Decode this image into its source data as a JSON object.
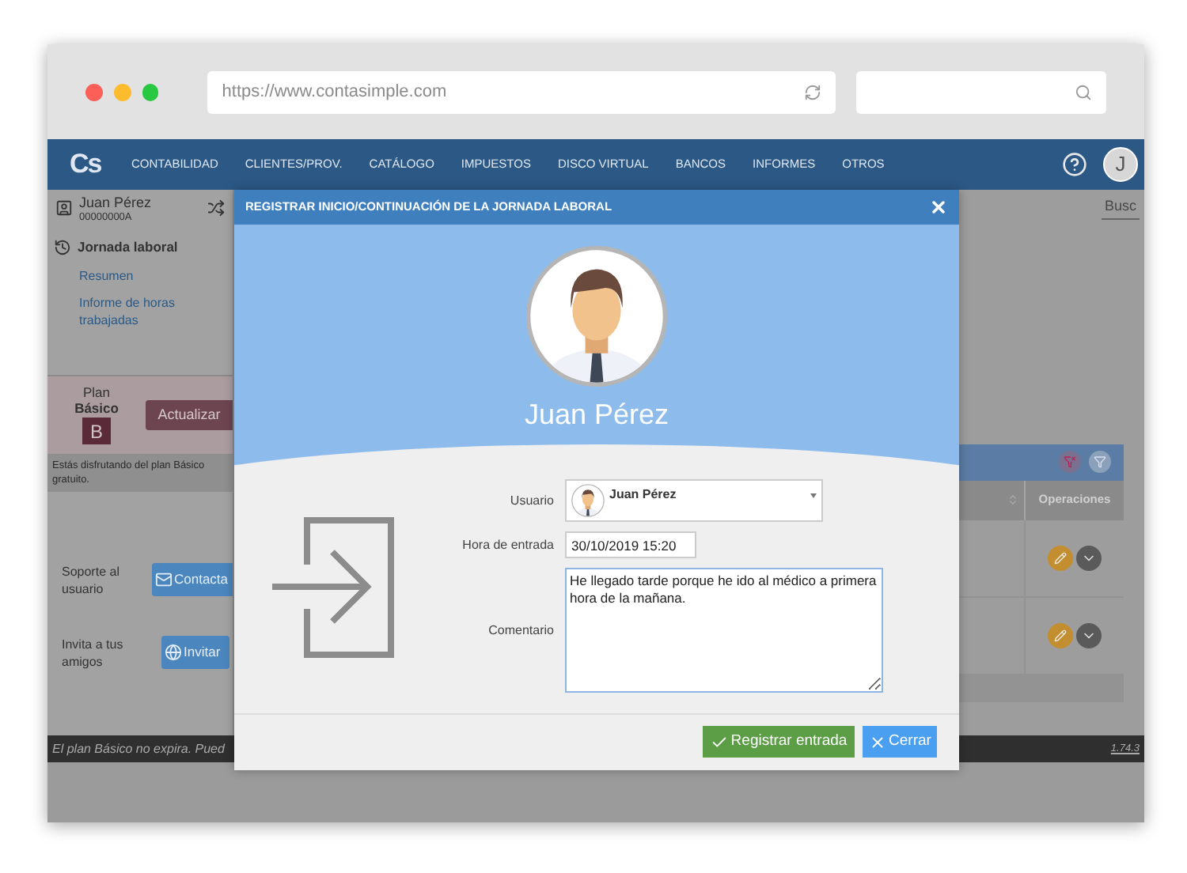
{
  "browser": {
    "url": "https://www.contasimple.com"
  },
  "nav": {
    "logo": "Cs",
    "items": [
      "CONTABILIDAD",
      "CLIENTES/PROV.",
      "CATÁLOGO",
      "IMPUESTOS",
      "DISCO VIRTUAL",
      "BANCOS",
      "INFORMES",
      "OTROS"
    ],
    "avatar_letter": "J"
  },
  "sidebar": {
    "user": {
      "name": "Juan Pérez",
      "id": "00000000A"
    },
    "section": {
      "title": "Jornada laboral",
      "links": [
        "Resumen",
        "Informe de horas trabajadas"
      ]
    },
    "plan": {
      "label": "Plan",
      "name": "Básico",
      "badge": "B",
      "button": "Actualizar",
      "note": "Estás disfrutando del plan Básico gratuito."
    },
    "support": {
      "label": "Soporte al usuario",
      "button": "Contacta"
    },
    "invite": {
      "label": "Invita a tus amigos",
      "button": "Invitar"
    }
  },
  "main": {
    "search_placeholder": "Busc",
    "table": {
      "columns": [
        "Operaciones"
      ]
    }
  },
  "footer": {
    "notice": "El plan Básico no expira. Pued",
    "version": "1.74.3"
  },
  "modal": {
    "title": "REGISTRAR INICIO/CONTINUACIÓN DE LA JORNADA LABORAL",
    "user_name": "Juan Pérez",
    "fields": [
      {
        "kind": "select",
        "label": "Usuario",
        "value": "Juan Pérez"
      },
      {
        "kind": "text",
        "label": "Hora de entrada",
        "value": "30/10/2019 15:20"
      },
      {
        "kind": "textarea",
        "label": "Comentario",
        "value": "He llegado tarde porque he ido al médico a primera hora de la mañana."
      }
    ],
    "buttons": [
      {
        "kind": "primary",
        "label": "Registrar entrada"
      },
      {
        "kind": "secondary",
        "label": "Cerrar"
      }
    ]
  }
}
